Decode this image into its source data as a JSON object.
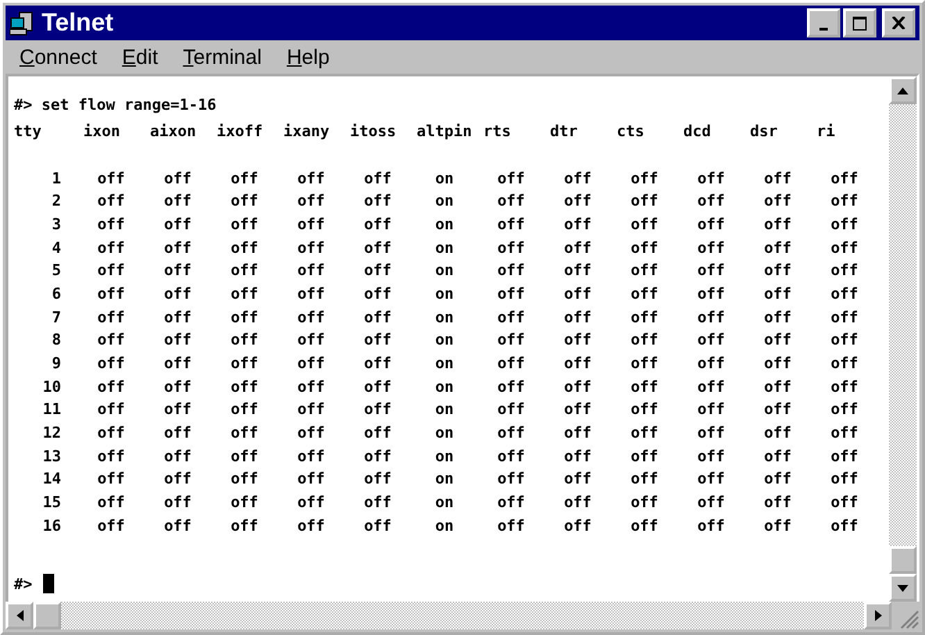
{
  "window": {
    "title": "Telnet"
  },
  "menu": [
    "Connect",
    "Edit",
    "Terminal",
    "Help"
  ],
  "terminal": {
    "command_line": "#> set flow range=1-16",
    "columns": [
      "tty",
      "ixon",
      "aixon",
      "ixoff",
      "ixany",
      "itoss",
      "altpin",
      "rts",
      "dtr",
      "cts",
      "dcd",
      "dsr",
      "ri"
    ],
    "rows": [
      [
        "1",
        "off",
        "off",
        "off",
        "off",
        "off",
        "on",
        "off",
        "off",
        "off",
        "off",
        "off",
        "off"
      ],
      [
        "2",
        "off",
        "off",
        "off",
        "off",
        "off",
        "on",
        "off",
        "off",
        "off",
        "off",
        "off",
        "off"
      ],
      [
        "3",
        "off",
        "off",
        "off",
        "off",
        "off",
        "on",
        "off",
        "off",
        "off",
        "off",
        "off",
        "off"
      ],
      [
        "4",
        "off",
        "off",
        "off",
        "off",
        "off",
        "on",
        "off",
        "off",
        "off",
        "off",
        "off",
        "off"
      ],
      [
        "5",
        "off",
        "off",
        "off",
        "off",
        "off",
        "on",
        "off",
        "off",
        "off",
        "off",
        "off",
        "off"
      ],
      [
        "6",
        "off",
        "off",
        "off",
        "off",
        "off",
        "on",
        "off",
        "off",
        "off",
        "off",
        "off",
        "off"
      ],
      [
        "7",
        "off",
        "off",
        "off",
        "off",
        "off",
        "on",
        "off",
        "off",
        "off",
        "off",
        "off",
        "off"
      ],
      [
        "8",
        "off",
        "off",
        "off",
        "off",
        "off",
        "on",
        "off",
        "off",
        "off",
        "off",
        "off",
        "off"
      ],
      [
        "9",
        "off",
        "off",
        "off",
        "off",
        "off",
        "on",
        "off",
        "off",
        "off",
        "off",
        "off",
        "off"
      ],
      [
        "10",
        "off",
        "off",
        "off",
        "off",
        "off",
        "on",
        "off",
        "off",
        "off",
        "off",
        "off",
        "off"
      ],
      [
        "11",
        "off",
        "off",
        "off",
        "off",
        "off",
        "on",
        "off",
        "off",
        "off",
        "off",
        "off",
        "off"
      ],
      [
        "12",
        "off",
        "off",
        "off",
        "off",
        "off",
        "on",
        "off",
        "off",
        "off",
        "off",
        "off",
        "off"
      ],
      [
        "13",
        "off",
        "off",
        "off",
        "off",
        "off",
        "on",
        "off",
        "off",
        "off",
        "off",
        "off",
        "off"
      ],
      [
        "14",
        "off",
        "off",
        "off",
        "off",
        "off",
        "on",
        "off",
        "off",
        "off",
        "off",
        "off",
        "off"
      ],
      [
        "15",
        "off",
        "off",
        "off",
        "off",
        "off",
        "on",
        "off",
        "off",
        "off",
        "off",
        "off",
        "off"
      ],
      [
        "16",
        "off",
        "off",
        "off",
        "off",
        "off",
        "on",
        "off",
        "off",
        "off",
        "off",
        "off",
        "off"
      ]
    ],
    "prompt": "#>"
  }
}
